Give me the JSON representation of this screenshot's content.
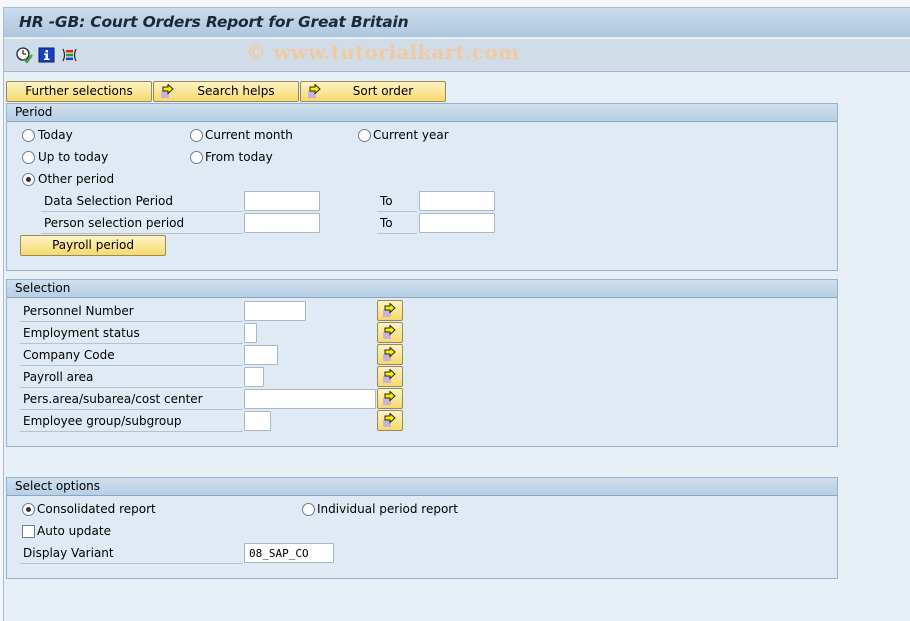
{
  "window": {
    "title": "HR -GB:  Court Orders Report for Great Britain",
    "watermark": "© www.tutorialkart.com"
  },
  "toolbar": {
    "icons": [
      {
        "name": "execute-clock-icon",
        "tooltip": "Execute"
      },
      {
        "name": "info-icon",
        "tooltip": "Program documentation"
      },
      {
        "name": "select-options-icon",
        "tooltip": "Selection options"
      }
    ]
  },
  "top_buttons": {
    "further_selections": "Further selections",
    "search_helps": "Search helps",
    "sort_order": "Sort order"
  },
  "period": {
    "title": "Period",
    "radios": {
      "today": "Today",
      "current_month": "Current month",
      "current_year": "Current year",
      "up_to_today": "Up to today",
      "from_today": "From today",
      "other_period": "Other period"
    },
    "selected": "other_period",
    "data_selection_period": {
      "label": "Data Selection Period",
      "from": "",
      "to_label": "To",
      "to": ""
    },
    "person_selection_period": {
      "label": "Person selection period",
      "from": "",
      "to_label": "To",
      "to": ""
    },
    "payroll_period_button": "Payroll period"
  },
  "selection": {
    "title": "Selection",
    "fields": [
      {
        "label": "Personnel Number",
        "value": ""
      },
      {
        "label": "Employment status",
        "value": ""
      },
      {
        "label": "Company Code",
        "value": ""
      },
      {
        "label": "Payroll area",
        "value": ""
      },
      {
        "label": "Pers.area/subarea/cost center",
        "value": ""
      },
      {
        "label": "Employee group/subgroup",
        "value": ""
      }
    ]
  },
  "select_options": {
    "title": "Select options",
    "consolidated_report": "Consolidated report",
    "individual_period_report": "Individual period report",
    "selected": "consolidated_report",
    "auto_update": {
      "label": "Auto update",
      "checked": false
    },
    "display_variant": {
      "label": "Display Variant",
      "value": "08_SAP_CO"
    }
  }
}
